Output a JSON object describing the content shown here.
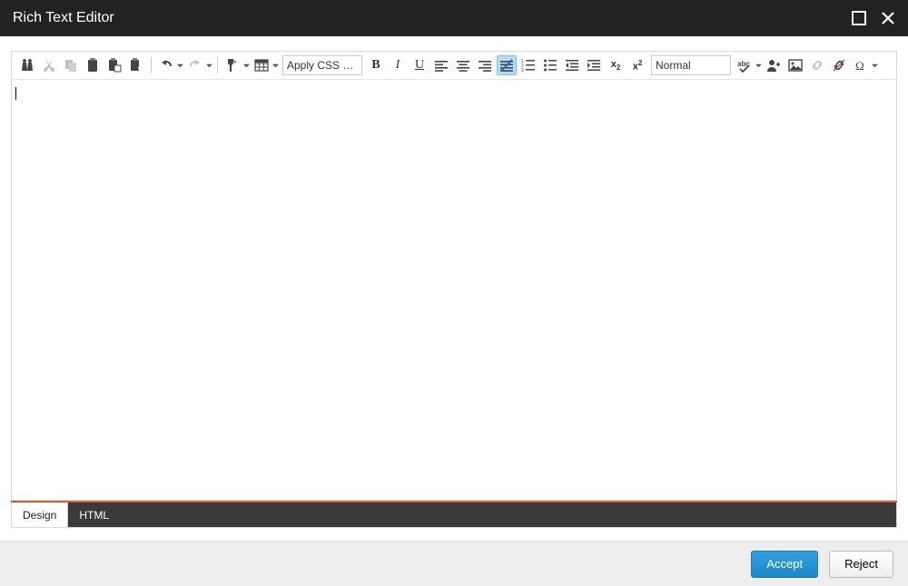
{
  "window": {
    "title": "Rich Text Editor"
  },
  "toolbar": {
    "find": "Find",
    "cut": "Cut",
    "copy": "Copy",
    "paste": "Paste",
    "paste_text": "Paste as text",
    "paste_html": "Paste from Word",
    "undo": "Undo",
    "redo": "Redo",
    "format_painter": "Format painter",
    "table": "Insert table",
    "css_class_label": "Apply CSS …",
    "bold": "B",
    "italic": "I",
    "underline": "U",
    "align_left": "Align left",
    "align_center": "Align center",
    "align_right": "Align right",
    "remove_format": "Remove format",
    "ordered_list": "Ordered list",
    "unordered_list": "Unordered list",
    "indent": "Increase indent",
    "outdent": "Decrease indent",
    "subscript": "x₂",
    "superscript": "x²",
    "paragraph_format_label": "Normal",
    "spellcheck": "Spellcheck",
    "insert_user": "Insert user",
    "insert_image": "Insert image",
    "insert_link": "Insert link",
    "unlink": "Unlink",
    "special_char": "Insert symbol"
  },
  "tabs": {
    "design": "Design",
    "html": "HTML"
  },
  "buttons": {
    "accept": "Accept",
    "reject": "Reject"
  }
}
